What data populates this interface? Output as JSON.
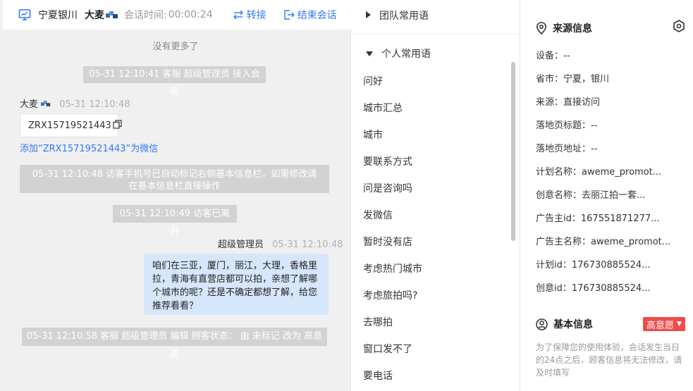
{
  "header": {
    "org": "宁夏银川",
    "visitor": "大麦",
    "session_time_label": "会话时间:",
    "session_time": "00:00:24",
    "transfer_label": "转接",
    "end_label": "结束会话"
  },
  "chat": {
    "no_more": "没有更多了",
    "notes": [
      "05-31 12:10:41 客服 超级管理员 接入会话",
      "05-31 12:10:48 访客手机号已自动标记右侧基本信息栏，如需修改请在基本信息栏直接操作",
      "05-31 12:10:49 访客已离开",
      "05-31 12:10:58 客服 超级管理员 编辑 顾客状态： 由 未标记 改为 高意愿"
    ],
    "visitor_msg": {
      "name": "大麦",
      "time": "05-31 12:10:48",
      "wechat_id": "ZRX15719521443",
      "add_wechat": "添加“ZRX15719521443”为微信"
    },
    "agent_msg": {
      "name": "超级管理员",
      "time": "05-31 12:10:48",
      "text": "咱们在三亚，厦门，丽江，大理，香格里拉，青海有直营店都可以拍，亲想了解哪个城市的呢？还是不确定都想了解，给您推荐看看？"
    }
  },
  "phrases": {
    "team_group": "团队常用语",
    "personal_group": "个人常用语",
    "items": [
      "问好",
      "城市汇总",
      "城市",
      "要联系方式",
      "问是咨询吗",
      "发微信",
      "暂时没有店",
      "考虑热门城市",
      "考虑旅拍吗?",
      "去哪拍",
      "窗口发不了",
      "要电话"
    ]
  },
  "source_info": {
    "title": "来源信息",
    "rows": [
      {
        "label": "设备：",
        "value": "--"
      },
      {
        "label": "省市：",
        "value": "宁夏，银川"
      },
      {
        "label": "来源：",
        "value": "直接访问"
      },
      {
        "label": "落地页标题：",
        "value": "--"
      },
      {
        "label": "落地页地址：",
        "value": "--"
      },
      {
        "label": "计划名称：",
        "value": "aweme_promot..."
      },
      {
        "label": "创意名称：",
        "value": "去丽江拍一套..."
      },
      {
        "label": "广告主id：",
        "value": "167551871277..."
      },
      {
        "label": "广告主名称：",
        "value": "aweme_promot..."
      },
      {
        "label": "计划id：",
        "value": "176730885524..."
      },
      {
        "label": "创意id：",
        "value": "176730885524..."
      }
    ]
  },
  "basic_info": {
    "title": "基本信息",
    "intent_badge": "高意愿",
    "notice": "为了保障您的使用体验，会话发生当日的24点之后，顾客信息将无法修改，请及时填写"
  },
  "colors": {
    "accent": "#3478f6",
    "badge": "#f04b4b",
    "agent_bubble": "#d6e6fb",
    "system_note": "#d2d2d2"
  }
}
